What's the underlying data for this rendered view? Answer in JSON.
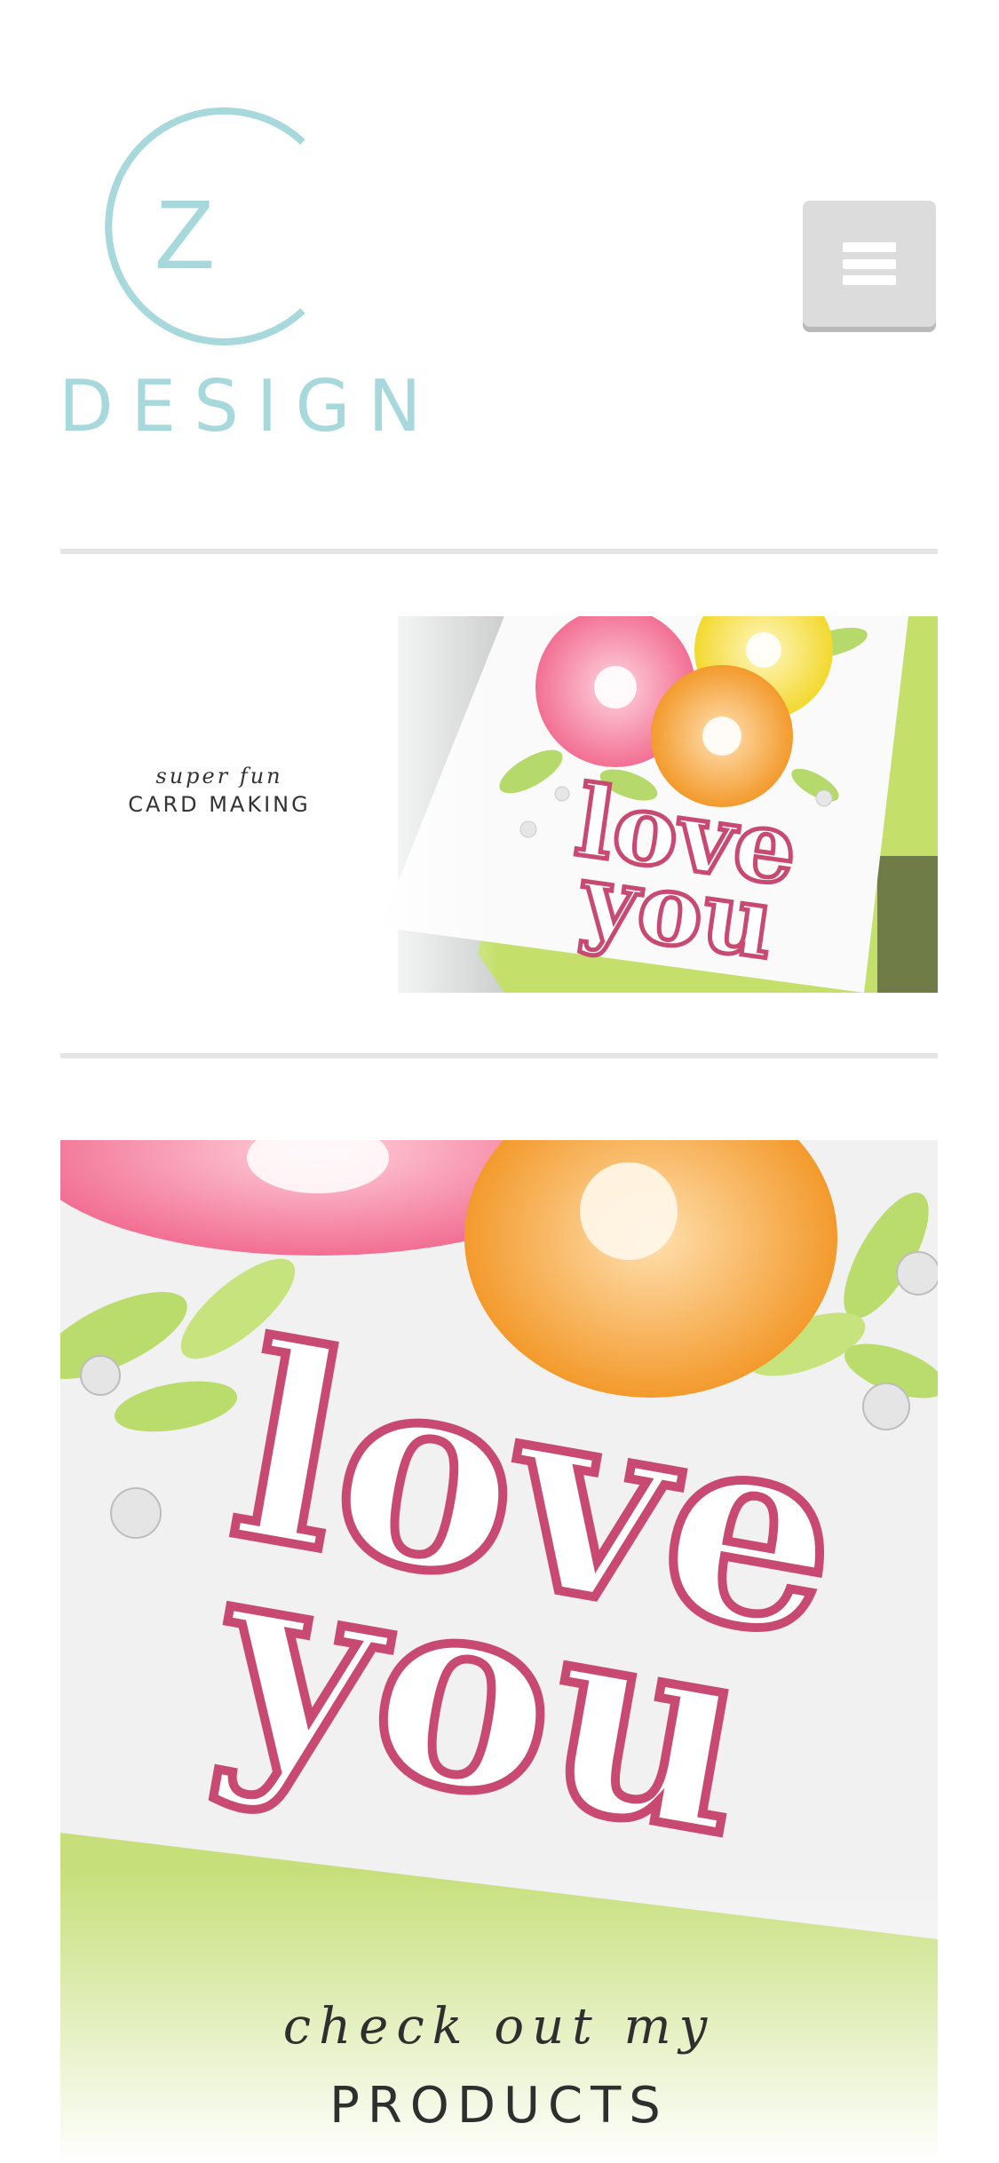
{
  "header": {
    "logo_letter": "Z",
    "logo_word": "DESIGN",
    "menu_icon": "hamburger-icon"
  },
  "banner": {
    "script_text": "super fun",
    "caps_text": "CARD MAKING",
    "card_text_line1": "love",
    "card_text_line2": "you"
  },
  "products": {
    "card_text_line1": "love",
    "card_text_line2": "you",
    "script_text": "check out my",
    "caps_text": "PRODUCTS"
  },
  "colors": {
    "logo_teal": "#a6d8dc",
    "menu_bg": "#dcdcdc",
    "divider": "#e5e5e5",
    "word_pink": "#c84a72",
    "flower_pink": "#f26f93",
    "flower_orange": "#f7a33a",
    "flower_yellow": "#f7e04a",
    "leaf_green": "#b5d96b"
  }
}
